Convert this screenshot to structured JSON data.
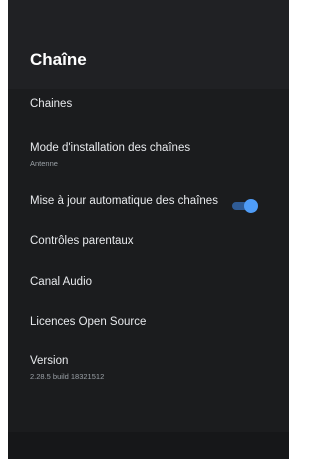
{
  "header": {
    "title": "Chaîne"
  },
  "menu": {
    "channels": {
      "label": "Chaines"
    },
    "install_mode": {
      "label": "Mode d'installation des chaînes",
      "value": "Antenne"
    },
    "auto_update": {
      "label": "Mise à jour automatique des chaînes",
      "enabled": true
    },
    "parental": {
      "label": "Contrôles parentaux"
    },
    "audio": {
      "label": "Canal Audio"
    },
    "licenses": {
      "label": "Licences Open Source"
    },
    "version": {
      "label": "Version",
      "value": "2.28.5 build 18321512"
    }
  },
  "colors": {
    "background": "#1b1c1e",
    "header": "#202124",
    "text": "#e8eaed",
    "subtext": "#9aa0a6",
    "toggle_on": "#4f9cf7"
  }
}
